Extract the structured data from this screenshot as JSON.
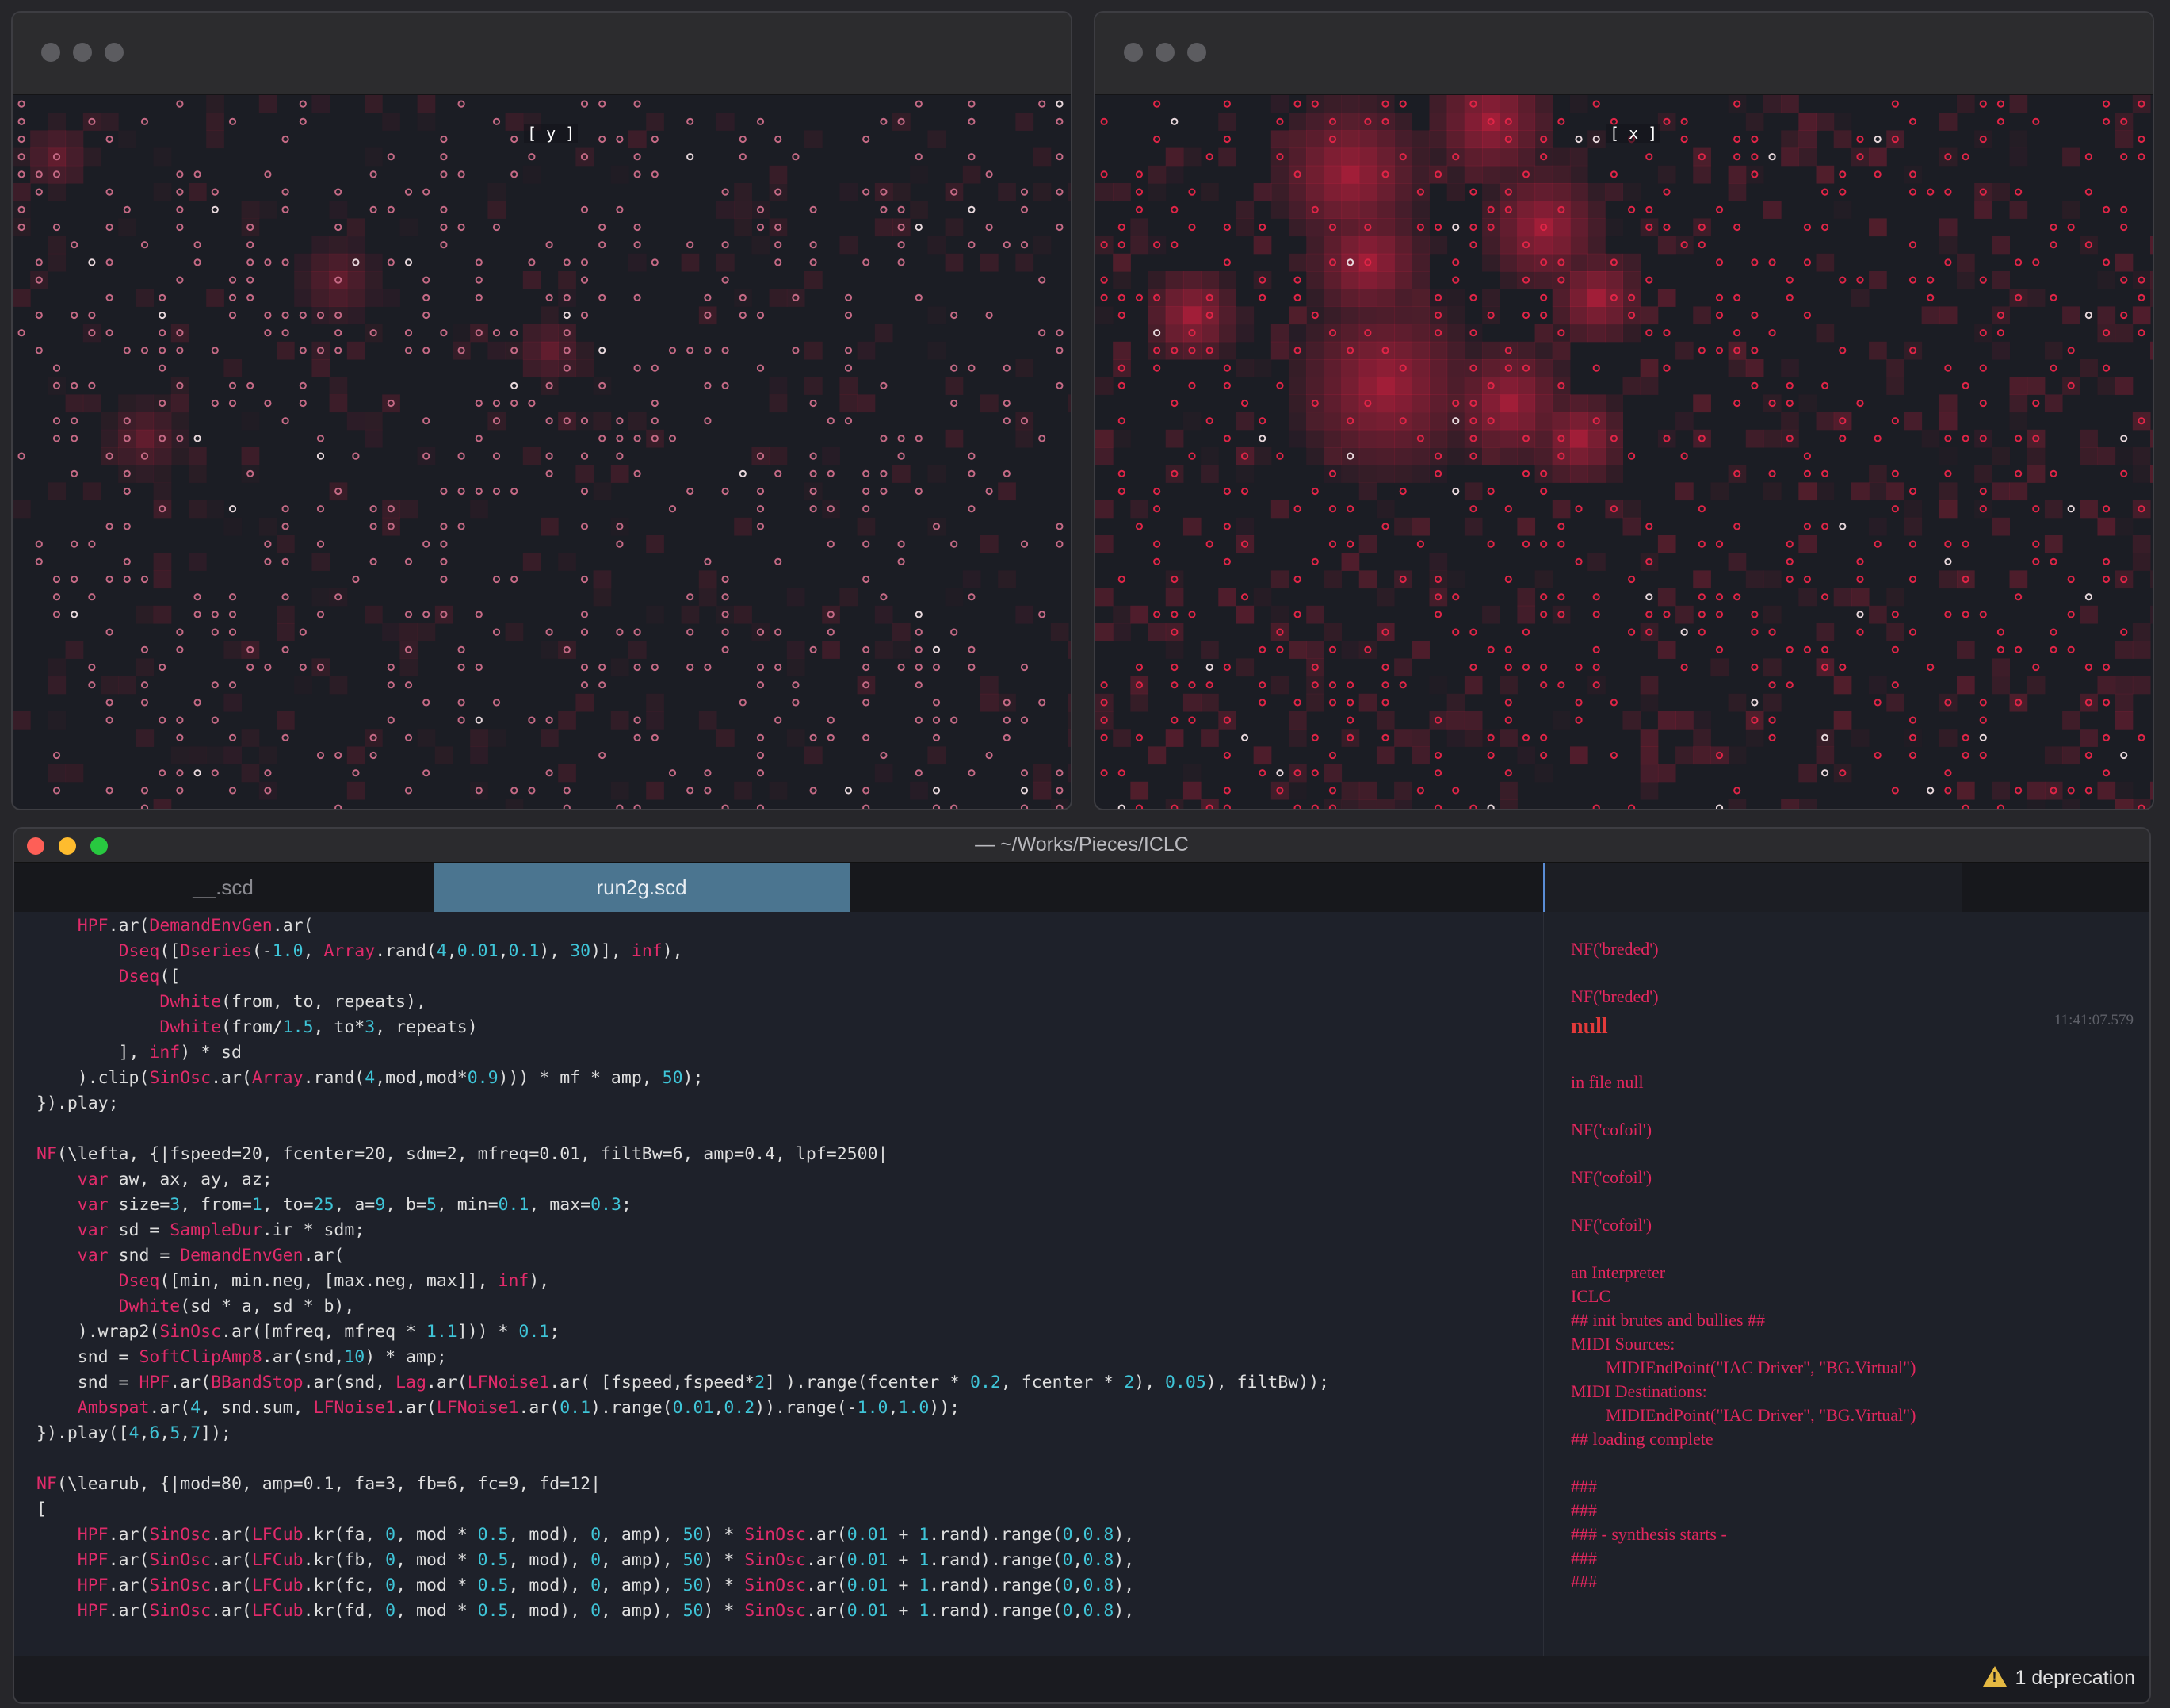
{
  "grid_windows": [
    {
      "label": "[ y ]",
      "intensity": "low"
    },
    {
      "label": "[ x ]",
      "intensity": "high"
    }
  ],
  "colors": {
    "cell": "#b81f3c",
    "circle_dim": "#c56a85",
    "circle_bright": "#e02547",
    "bg": "#1b1d24"
  },
  "editor": {
    "title": "— ~/Works/Pieces/ICLC",
    "tabs": [
      "__.scd",
      "run2g.scd"
    ],
    "active_tab": "run2g.scd",
    "code_lines": [
      [
        [
          "    ",
          "d"
        ],
        [
          "HPF",
          "k"
        ],
        [
          ".ar(",
          "d"
        ],
        [
          "DemandEnvGen",
          "k"
        ],
        [
          ".ar(",
          "d"
        ]
      ],
      [
        [
          "        ",
          "d"
        ],
        [
          "Dseq",
          "k"
        ],
        [
          "([",
          "d"
        ],
        [
          "Dseries",
          "k"
        ],
        [
          "(-",
          "d"
        ],
        [
          "1.0",
          "n"
        ],
        [
          ", ",
          "d"
        ],
        [
          "Array",
          "k"
        ],
        [
          ".rand(",
          "d"
        ],
        [
          "4",
          "n"
        ],
        [
          ",",
          "d"
        ],
        [
          "0.01",
          "n"
        ],
        [
          ",",
          "d"
        ],
        [
          "0.1",
          "n"
        ],
        [
          "), ",
          "d"
        ],
        [
          "30",
          "n"
        ],
        [
          ")], ",
          "d"
        ],
        [
          "inf",
          "k"
        ],
        [
          "),",
          "d"
        ]
      ],
      [
        [
          "        ",
          "d"
        ],
        [
          "Dseq",
          "k"
        ],
        [
          "([",
          "d"
        ]
      ],
      [
        [
          "            ",
          "d"
        ],
        [
          "Dwhite",
          "k"
        ],
        [
          "(from, to, repeats),",
          "d"
        ]
      ],
      [
        [
          "            ",
          "d"
        ],
        [
          "Dwhite",
          "k"
        ],
        [
          "(from/",
          "d"
        ],
        [
          "1.5",
          "n"
        ],
        [
          ", to*",
          "d"
        ],
        [
          "3",
          "n"
        ],
        [
          ", repeats)",
          "d"
        ]
      ],
      [
        [
          "        ], ",
          "d"
        ],
        [
          "inf",
          "k"
        ],
        [
          ") * sd",
          "d"
        ]
      ],
      [
        [
          "    ).clip(",
          "d"
        ],
        [
          "SinOsc",
          "k"
        ],
        [
          ".ar(",
          "d"
        ],
        [
          "Array",
          "k"
        ],
        [
          ".rand(",
          "d"
        ],
        [
          "4",
          "n"
        ],
        [
          ",mod,mod*",
          "d"
        ],
        [
          "0.9",
          "n"
        ],
        [
          "))) * mf * amp, ",
          "d"
        ],
        [
          "50",
          "n"
        ],
        [
          ");",
          "d"
        ]
      ],
      [
        [
          "}).play;",
          "d"
        ]
      ],
      [
        [
          "",
          "d"
        ]
      ],
      [
        [
          "NF",
          "k"
        ],
        [
          "(\\lefta, {|fspeed=",
          "d"
        ],
        [
          "20",
          "d"
        ],
        [
          ", fcenter=",
          "d"
        ],
        [
          "20",
          "d"
        ],
        [
          ", sdm=",
          "d"
        ],
        [
          "2",
          "d"
        ],
        [
          ", mfreq=",
          "d"
        ],
        [
          "0.01",
          "d"
        ],
        [
          ", filtBw=",
          "d"
        ],
        [
          "6",
          "d"
        ],
        [
          ", amp=",
          "d"
        ],
        [
          "0.4",
          "d"
        ],
        [
          ", lpf=",
          "d"
        ],
        [
          "2500",
          "d"
        ],
        [
          "|",
          "d"
        ]
      ],
      [
        [
          "    ",
          "d"
        ],
        [
          "var",
          "k"
        ],
        [
          " aw, ax, ay, az;",
          "d"
        ]
      ],
      [
        [
          "    ",
          "d"
        ],
        [
          "var",
          "k"
        ],
        [
          " size=",
          "d"
        ],
        [
          "3",
          "n"
        ],
        [
          ", from=",
          "d"
        ],
        [
          "1",
          "n"
        ],
        [
          ", to=",
          "d"
        ],
        [
          "25",
          "n"
        ],
        [
          ", a=",
          "d"
        ],
        [
          "9",
          "n"
        ],
        [
          ", b=",
          "d"
        ],
        [
          "5",
          "n"
        ],
        [
          ", min=",
          "d"
        ],
        [
          "0.1",
          "n"
        ],
        [
          ", max=",
          "d"
        ],
        [
          "0.3",
          "n"
        ],
        [
          ";",
          "d"
        ]
      ],
      [
        [
          "    ",
          "d"
        ],
        [
          "var",
          "k"
        ],
        [
          " sd = ",
          "d"
        ],
        [
          "SampleDur",
          "k"
        ],
        [
          ".ir * sdm;",
          "d"
        ]
      ],
      [
        [
          "    ",
          "d"
        ],
        [
          "var",
          "k"
        ],
        [
          " snd = ",
          "d"
        ],
        [
          "DemandEnvGen",
          "k"
        ],
        [
          ".ar(",
          "d"
        ]
      ],
      [
        [
          "        ",
          "d"
        ],
        [
          "Dseq",
          "k"
        ],
        [
          "([min, min.neg, [max.neg, max]], ",
          "d"
        ],
        [
          "inf",
          "k"
        ],
        [
          "),",
          "d"
        ]
      ],
      [
        [
          "        ",
          "d"
        ],
        [
          "Dwhite",
          "k"
        ],
        [
          "(sd * a, sd * b),",
          "d"
        ]
      ],
      [
        [
          "    ).wrap2(",
          "d"
        ],
        [
          "SinOsc",
          "k"
        ],
        [
          ".ar([mfreq, mfreq * ",
          "d"
        ],
        [
          "1.1",
          "n"
        ],
        [
          "])) * ",
          "d"
        ],
        [
          "0.1",
          "n"
        ],
        [
          ";",
          "d"
        ]
      ],
      [
        [
          "    snd = ",
          "d"
        ],
        [
          "SoftClipAmp8",
          "k"
        ],
        [
          ".ar(snd,",
          "d"
        ],
        [
          "10",
          "n"
        ],
        [
          ") * amp;",
          "d"
        ]
      ],
      [
        [
          "    snd = ",
          "d"
        ],
        [
          "HPF",
          "k"
        ],
        [
          ".ar(",
          "d"
        ],
        [
          "BBandStop",
          "k"
        ],
        [
          ".ar(snd, ",
          "d"
        ],
        [
          "Lag",
          "k"
        ],
        [
          ".ar(",
          "d"
        ],
        [
          "LFNoise1",
          "k"
        ],
        [
          ".ar( [fspeed,fspeed*",
          "d"
        ],
        [
          "2",
          "n"
        ],
        [
          "] ).range(fcenter * ",
          "d"
        ],
        [
          "0.2",
          "n"
        ],
        [
          ", fcenter * ",
          "d"
        ],
        [
          "2",
          "n"
        ],
        [
          "), ",
          "d"
        ],
        [
          "0.05",
          "n"
        ],
        [
          "), filtBw));",
          "d"
        ]
      ],
      [
        [
          "    ",
          "d"
        ],
        [
          "Ambspat",
          "k"
        ],
        [
          ".ar(",
          "d"
        ],
        [
          "4",
          "n"
        ],
        [
          ", snd.sum, ",
          "d"
        ],
        [
          "LFNoise1",
          "k"
        ],
        [
          ".ar(",
          "d"
        ],
        [
          "LFNoise1",
          "k"
        ],
        [
          ".ar(",
          "d"
        ],
        [
          "0.1",
          "n"
        ],
        [
          ").range(",
          "d"
        ],
        [
          "0.01",
          "n"
        ],
        [
          ",",
          "d"
        ],
        [
          "0.2",
          "n"
        ],
        [
          ")).range(-",
          "d"
        ],
        [
          "1.0",
          "n"
        ],
        [
          ",",
          "d"
        ],
        [
          "1.0",
          "n"
        ],
        [
          "));",
          "d"
        ]
      ],
      [
        [
          "}).play([",
          "d"
        ],
        [
          "4",
          "n"
        ],
        [
          ",",
          "d"
        ],
        [
          "6",
          "n"
        ],
        [
          ",",
          "d"
        ],
        [
          "5",
          "n"
        ],
        [
          ",",
          "d"
        ],
        [
          "7",
          "n"
        ],
        [
          "]);",
          "d"
        ]
      ],
      [
        [
          "",
          "d"
        ]
      ],
      [
        [
          "NF",
          "k"
        ],
        [
          "(\\learub, {|mod=",
          "d"
        ],
        [
          "80",
          "d"
        ],
        [
          ", amp=",
          "d"
        ],
        [
          "0.1",
          "d"
        ],
        [
          ", fa=",
          "d"
        ],
        [
          "3",
          "d"
        ],
        [
          ", fb=",
          "d"
        ],
        [
          "6",
          "d"
        ],
        [
          ", fc=",
          "d"
        ],
        [
          "9",
          "d"
        ],
        [
          ", fd=",
          "d"
        ],
        [
          "12",
          "d"
        ],
        [
          "|",
          "d"
        ]
      ],
      [
        [
          "[",
          "d"
        ]
      ],
      [
        [
          "    ",
          "d"
        ],
        [
          "HPF",
          "k"
        ],
        [
          ".ar(",
          "d"
        ],
        [
          "SinOsc",
          "k"
        ],
        [
          ".ar(",
          "d"
        ],
        [
          "LFCub",
          "k"
        ],
        [
          ".kr(fa, ",
          "d"
        ],
        [
          "0",
          "n"
        ],
        [
          ", mod * ",
          "d"
        ],
        [
          "0.5",
          "n"
        ],
        [
          ", mod), ",
          "d"
        ],
        [
          "0",
          "n"
        ],
        [
          ", amp), ",
          "d"
        ],
        [
          "50",
          "n"
        ],
        [
          ") * ",
          "d"
        ],
        [
          "SinOsc",
          "k"
        ],
        [
          ".ar(",
          "d"
        ],
        [
          "0.01",
          "n"
        ],
        [
          " + ",
          "d"
        ],
        [
          "1",
          "n"
        ],
        [
          ".rand).range(",
          "d"
        ],
        [
          "0",
          "n"
        ],
        [
          ",",
          "d"
        ],
        [
          "0.8",
          "n"
        ],
        [
          "),",
          "d"
        ]
      ],
      [
        [
          "    ",
          "d"
        ],
        [
          "HPF",
          "k"
        ],
        [
          ".ar(",
          "d"
        ],
        [
          "SinOsc",
          "k"
        ],
        [
          ".ar(",
          "d"
        ],
        [
          "LFCub",
          "k"
        ],
        [
          ".kr(fb, ",
          "d"
        ],
        [
          "0",
          "n"
        ],
        [
          ", mod * ",
          "d"
        ],
        [
          "0.5",
          "n"
        ],
        [
          ", mod), ",
          "d"
        ],
        [
          "0",
          "n"
        ],
        [
          ", amp), ",
          "d"
        ],
        [
          "50",
          "n"
        ],
        [
          ") * ",
          "d"
        ],
        [
          "SinOsc",
          "k"
        ],
        [
          ".ar(",
          "d"
        ],
        [
          "0.01",
          "n"
        ],
        [
          " + ",
          "d"
        ],
        [
          "1",
          "n"
        ],
        [
          ".rand).range(",
          "d"
        ],
        [
          "0",
          "n"
        ],
        [
          ",",
          "d"
        ],
        [
          "0.8",
          "n"
        ],
        [
          "),",
          "d"
        ]
      ],
      [
        [
          "    ",
          "d"
        ],
        [
          "HPF",
          "k"
        ],
        [
          ".ar(",
          "d"
        ],
        [
          "SinOsc",
          "k"
        ],
        [
          ".ar(",
          "d"
        ],
        [
          "LFCub",
          "k"
        ],
        [
          ".kr(fc, ",
          "d"
        ],
        [
          "0",
          "n"
        ],
        [
          ", mod * ",
          "d"
        ],
        [
          "0.5",
          "n"
        ],
        [
          ", mod), ",
          "d"
        ],
        [
          "0",
          "n"
        ],
        [
          ", amp), ",
          "d"
        ],
        [
          "50",
          "n"
        ],
        [
          ") * ",
          "d"
        ],
        [
          "SinOsc",
          "k"
        ],
        [
          ".ar(",
          "d"
        ],
        [
          "0.01",
          "n"
        ],
        [
          " + ",
          "d"
        ],
        [
          "1",
          "n"
        ],
        [
          ".rand).range(",
          "d"
        ],
        [
          "0",
          "n"
        ],
        [
          ",",
          "d"
        ],
        [
          "0.8",
          "n"
        ],
        [
          "),",
          "d"
        ]
      ],
      [
        [
          "    ",
          "d"
        ],
        [
          "HPF",
          "k"
        ],
        [
          ".ar(",
          "d"
        ],
        [
          "SinOsc",
          "k"
        ],
        [
          ".ar(",
          "d"
        ],
        [
          "LFCub",
          "k"
        ],
        [
          ".kr(fd, ",
          "d"
        ],
        [
          "0",
          "n"
        ],
        [
          ", mod * ",
          "d"
        ],
        [
          "0.5",
          "n"
        ],
        [
          ", mod), ",
          "d"
        ],
        [
          "0",
          "n"
        ],
        [
          ", amp), ",
          "d"
        ],
        [
          "50",
          "n"
        ],
        [
          ") * ",
          "d"
        ],
        [
          "SinOsc",
          "k"
        ],
        [
          ".ar(",
          "d"
        ],
        [
          "0.01",
          "n"
        ],
        [
          " + ",
          "d"
        ],
        [
          "1",
          "n"
        ],
        [
          ".rand).range(",
          "d"
        ],
        [
          "0",
          "n"
        ],
        [
          ",",
          "d"
        ],
        [
          "0.8",
          "n"
        ],
        [
          "),",
          "d"
        ]
      ]
    ],
    "post": [
      {
        "text": "NF('breded')"
      },
      {
        "text": "NF('breded')"
      },
      {
        "text": "null",
        "cls": "null"
      },
      {
        "text": "in file null"
      },
      {
        "text": "NF('cofoil')"
      },
      {
        "text": "NF('cofoil')"
      },
      {
        "text": "NF('cofoil')"
      },
      {
        "text": "an Interpreter"
      },
      {
        "text": "ICLC"
      },
      {
        "text": "## init brutes and bullies ##"
      },
      {
        "text": "MIDI Sources:"
      },
      {
        "text": "        MIDIEndPoint(\"IAC Driver\", \"BG.Virtual\")"
      },
      {
        "text": "MIDI Destinations:"
      },
      {
        "text": "        MIDIEndPoint(\"IAC Driver\", \"BG.Virtual\")"
      },
      {
        "text": "## loading complete"
      },
      {
        "text": "###"
      },
      {
        "text": "###"
      },
      {
        "text": "### - synthesis starts -"
      },
      {
        "text": "###"
      },
      {
        "text": "###"
      }
    ],
    "timestamp": "11:41:07.579",
    "status": {
      "warning": "1 deprecation"
    }
  }
}
